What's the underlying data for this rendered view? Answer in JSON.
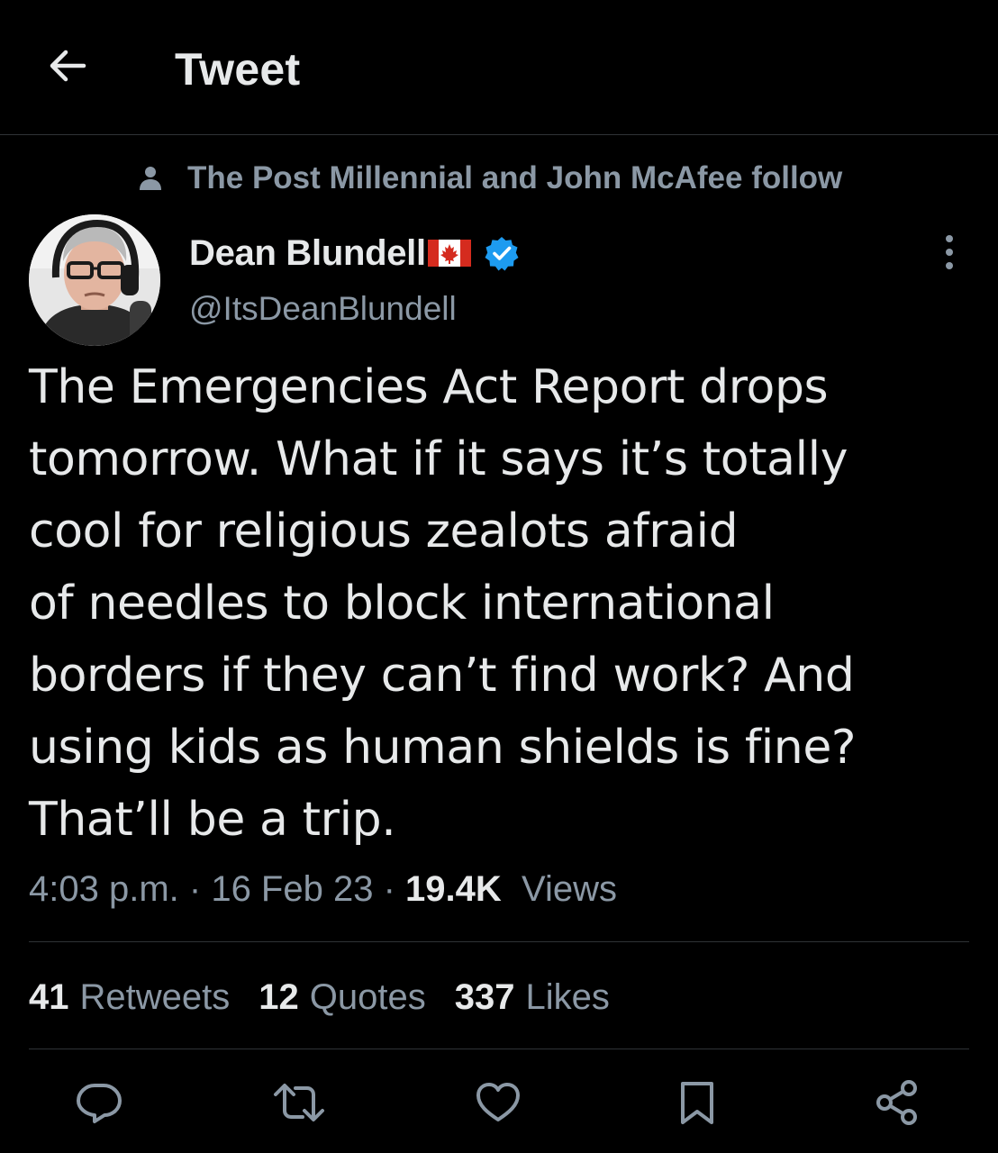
{
  "header": {
    "title": "Tweet",
    "back_icon": "arrow-left-icon"
  },
  "social_context": {
    "icon": "person-icon",
    "text": "The Post Millennial and John McAfee follow"
  },
  "author": {
    "display_name": "Dean Blundell",
    "flag_icon": "canada-flag-icon",
    "verified_icon": "verified-badge-icon",
    "handle": "@ItsDeanBlundell"
  },
  "tweet": {
    "text": "The Emergencies Act Report drops\ntomorrow. What if it says it’s totally\ncool for religious zealots afraid\nof needles to block international\nborders if they can’t find work? And\nusing kids as human shields is fine?\nThat’ll be a trip.",
    "time": "4:03 p.m.",
    "separator": "·",
    "date": "16 Feb 23",
    "views_count": "19.4K",
    "views_label": "Views"
  },
  "stats": {
    "retweets_count": "41",
    "retweets_label": "Retweets",
    "quotes_count": "12",
    "quotes_label": "Quotes",
    "likes_count": "337",
    "likes_label": "Likes"
  },
  "actions": [
    "reply-icon",
    "retweet-icon",
    "like-icon",
    "bookmark-icon",
    "share-icon"
  ],
  "colors": {
    "background": "#000000",
    "text_primary": "#e7e9ea",
    "text_secondary": "#8b98a5",
    "divider": "#2f3336",
    "verified_blue": "#1d9bf0",
    "flag_red": "#d52b1e"
  }
}
